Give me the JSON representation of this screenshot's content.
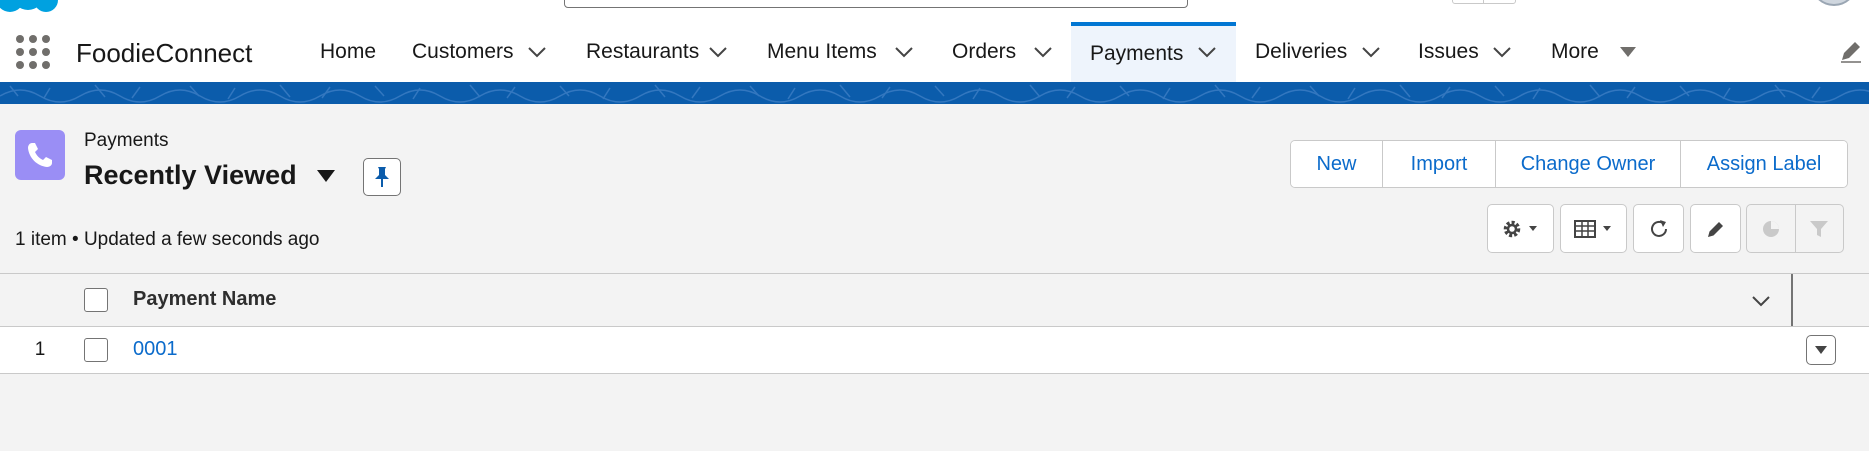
{
  "app": {
    "name": "FoodieConnect"
  },
  "nav": {
    "items": [
      {
        "label": "Home",
        "has_menu": false,
        "active": false
      },
      {
        "label": "Customers",
        "has_menu": true,
        "active": false
      },
      {
        "label": "Restaurants",
        "has_menu": true,
        "active": false
      },
      {
        "label": "Menu Items",
        "has_menu": true,
        "active": false
      },
      {
        "label": "Orders",
        "has_menu": true,
        "active": false
      },
      {
        "label": "Payments",
        "has_menu": true,
        "active": true
      },
      {
        "label": "Deliveries",
        "has_menu": true,
        "active": false
      },
      {
        "label": "Issues",
        "has_menu": true,
        "active": false
      },
      {
        "label": "More",
        "has_menu": true,
        "active": false
      }
    ]
  },
  "list_view": {
    "object_label": "Payments",
    "view_name": "Recently Viewed",
    "status": "1 item • Updated a few seconds ago",
    "actions": [
      "New",
      "Import",
      "Change Owner",
      "Assign Label"
    ],
    "column_header": "Payment Name",
    "rows": [
      {
        "number": "1",
        "name": "0001"
      }
    ]
  },
  "icons": {
    "launcher": "app-launcher-icon",
    "object": "phone-icon",
    "pin": "pin-icon",
    "settings": "gear-icon",
    "display_as": "table-icon",
    "refresh": "refresh-icon",
    "edit_list": "pencil-icon",
    "charts": "pie-chart-icon",
    "filter": "filter-icon"
  },
  "colors": {
    "brand_band": "#0b5cab",
    "active_tab_border": "#0176d3",
    "active_tab_bg": "#eef4fc",
    "link": "#0b6bcb",
    "object_icon": "#9a8ef5"
  }
}
